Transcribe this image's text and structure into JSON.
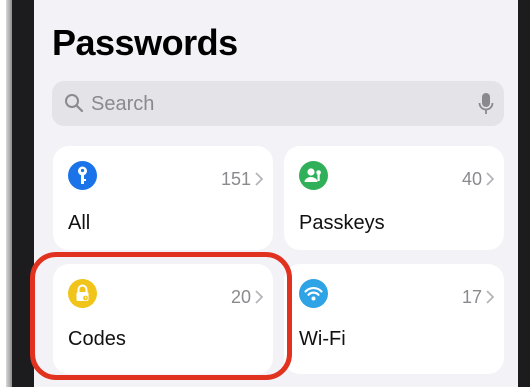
{
  "header": {
    "title": "Passwords"
  },
  "search": {
    "placeholder": "Search"
  },
  "categories": [
    {
      "label": "All",
      "count": "151",
      "icon": "key-icon",
      "color": "#1a73e8"
    },
    {
      "label": "Passkeys",
      "count": "40",
      "icon": "person-key-icon",
      "color": "#31b05a"
    },
    {
      "label": "Codes",
      "count": "20",
      "icon": "lock-code-icon",
      "color": "#f0c419"
    },
    {
      "label": "Wi-Fi",
      "count": "17",
      "icon": "wifi-icon",
      "color": "#2ea3e6"
    }
  ],
  "highlight": {
    "color": "#e0321f"
  }
}
